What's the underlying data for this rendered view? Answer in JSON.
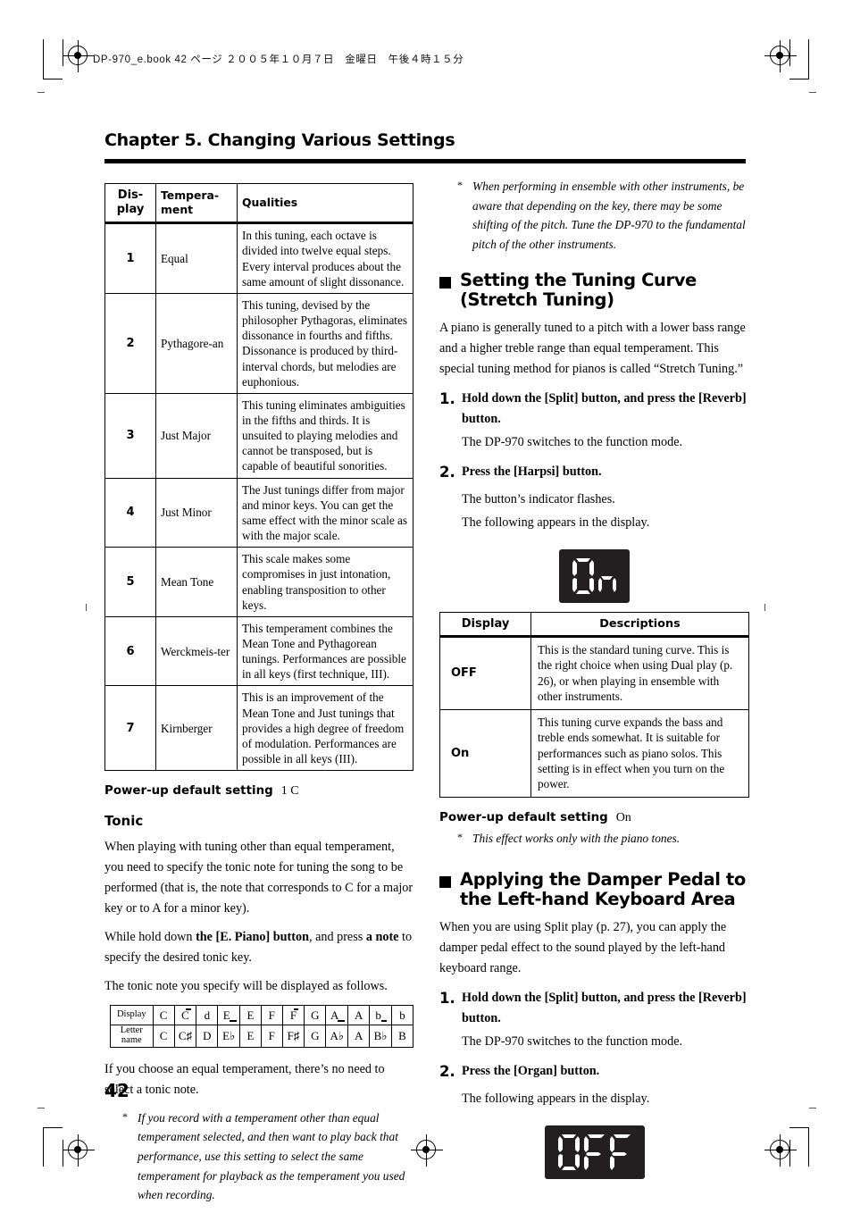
{
  "print_header": "DP-970_e.book  42 ページ  ２００５年１０月７日　金曜日　午後４時１５分",
  "chapter_title": "Chapter 5. Changing Various Settings",
  "page_number": "42",
  "left_column": {
    "temperament_table": {
      "headers": [
        "Dis-play",
        "Tempera-ment",
        "Qualities"
      ],
      "header_display": "Dis-\nplay",
      "header_temperament": "Tempera-\nment",
      "header_qualities": "Qualities",
      "rows": [
        {
          "display": "1",
          "temperament": "Equal",
          "qualities": "In this tuning, each octave is divided into twelve equal steps. Every interval produces about the same amount of slight dissonance."
        },
        {
          "display": "2",
          "temperament": "Pythagore-an",
          "qualities": "This tuning, devised by the philosopher Pythagoras, eliminates dissonance in fourths and fifths. Dissonance is produced by third-interval chords, but melodies are euphonious."
        },
        {
          "display": "3",
          "temperament": "Just Major",
          "qualities": "This tuning eliminates ambiguities in the fifths and thirds. It is unsuited to playing melodies and cannot be transposed, but is capable of beautiful sonorities."
        },
        {
          "display": "4",
          "temperament": "Just Minor",
          "qualities": "The Just tunings differ from major and minor keys. You can get the same effect with the minor scale as with the major scale."
        },
        {
          "display": "5",
          "temperament": "Mean Tone",
          "qualities": "This scale makes some compromises in just intonation, enabling transposition to other keys."
        },
        {
          "display": "6",
          "temperament": "Werckmeis-ter",
          "qualities": "This temperament combines the Mean Tone and Pythagorean tunings. Performances are possible in all keys (first technique, III)."
        },
        {
          "display": "7",
          "temperament": "Kirnberger",
          "qualities": "This is an improvement of the Mean Tone and Just tunings that provides a high degree of freedom of modulation. Performances are possible in all keys (III)."
        }
      ]
    },
    "powerup_label": "Power-up default setting",
    "powerup_value": "1 C",
    "tonic_heading": "Tonic",
    "tonic_para1": "When playing with tuning other than equal temperament, you need to specify the tonic note for tuning the song to be performed (that is, the note that corresponds to C for a major key or to A for a minor key).",
    "tonic_para2_pre": "While hold down ",
    "tonic_para2_b1": "the [E. Piano] button",
    "tonic_para2_mid": ", and press ",
    "tonic_para2_b2": "a note",
    "tonic_para2_post": " to specify the desired tonic key.",
    "tonic_para3": "The tonic note you specify will be displayed as follows.",
    "note_table": {
      "row1_label": "Display",
      "row2_label": "Letter name",
      "display_row": [
        "C",
        "C̄",
        "d",
        "E_",
        "E",
        "F",
        "F̄",
        "G",
        "A_",
        "A",
        "b_",
        "b"
      ],
      "letter_row": [
        "C",
        "C♯",
        "D",
        "E♭",
        "E",
        "F",
        "F♯",
        "G",
        "A♭",
        "A",
        "B♭",
        "B"
      ]
    },
    "tonic_para4": "If you choose an equal temperament, there’s no need to select a tonic note.",
    "tonic_note_star": "*",
    "tonic_note": "If you record with a temperament other than equal temperament selected, and then want to play back that performance, use this setting to select the same temperament for playback as the temperament you used when recording."
  },
  "right_column": {
    "top_note_star": "*",
    "top_note": "When performing in ensemble with other instruments, be aware that depending on the key, there may be some shifting of the pitch. Tune the DP-970 to the fundamental pitch of the other instruments.",
    "section1_title": "Setting the Tuning Curve (Stretch Tuning)",
    "section1_para": "A piano is generally tuned to a pitch with a lower bass range and a higher treble range than equal temperament. This special tuning method for pianos is called “Stretch Tuning.”",
    "section1_step1_num": "1.",
    "section1_step1_title": "Hold down the [Split] button, and press the [Reverb] button.",
    "section1_step1_sub": "The DP-970 switches to the function mode.",
    "section1_step2_num": "2.",
    "section1_step2_title": "Press the [Harpsi] button.",
    "section1_step2_sub1": "The button’s indicator flashes.",
    "section1_step2_sub2": "The following appears in the display.",
    "led1_value": "On",
    "curve_table": {
      "header_display": "Display",
      "header_descriptions": "Descriptions",
      "rows": [
        {
          "display": "OFF",
          "description": "This is the standard tuning curve. This is the right choice when using Dual play (p. 26), or when playing in ensemble with other instruments."
        },
        {
          "display": "On",
          "description": "This tuning curve expands the bass and treble ends somewhat. It is suitable for performances such as piano solos. This setting is in effect when you turn on the power."
        }
      ]
    },
    "powerup_label": "Power-up default setting",
    "powerup_value": "On",
    "piano_note_star": "*",
    "piano_note": "This effect works only with the piano tones.",
    "section2_title": "Applying the Damper Pedal to the Left-hand Keyboard Area",
    "section2_para": "When you are using Split play (p. 27), you can apply the damper pedal effect to the sound played by the left-hand keyboard range.",
    "section2_step1_num": "1.",
    "section2_step1_title": "Hold down the [Split] button, and press the [Reverb] button.",
    "section2_step1_sub": "The DP-970 switches to the function mode.",
    "section2_step2_num": "2.",
    "section2_step2_title": "Press the [Organ] button.",
    "section2_step2_sub": "The following appears in the display.",
    "led2_value": "OFF"
  },
  "colors": {
    "ink": "#000000",
    "led_background": "#231f20",
    "led_segment": "#ffffff",
    "paper": "#ffffff"
  }
}
